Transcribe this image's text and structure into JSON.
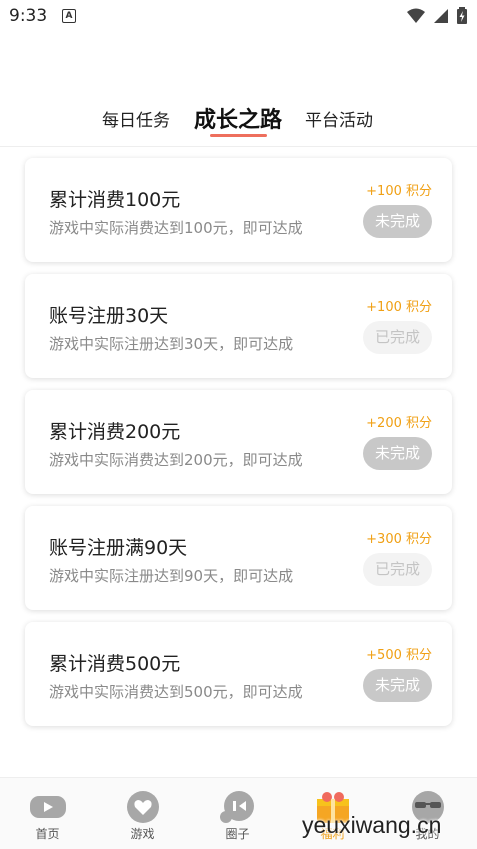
{
  "status_bar": {
    "time": "9:33",
    "notification_icon_letter": "A"
  },
  "tabs": [
    {
      "label": "每日任务",
      "active": false
    },
    {
      "label": "成长之路",
      "active": true
    },
    {
      "label": "平台活动",
      "active": false
    }
  ],
  "accent_colors": {
    "tab_underline": "#ee6f5d",
    "points": "#f0a015"
  },
  "tasks": [
    {
      "title": "累计消费100元",
      "desc": "游戏中实际消费达到100元，即可达成",
      "points": "+100 积分",
      "status": "未完成",
      "state": "pending"
    },
    {
      "title": "账号注册30天",
      "desc": "游戏中实际注册达到30天，即可达成",
      "points": "+100 积分",
      "status": "已完成",
      "state": "done"
    },
    {
      "title": "累计消费200元",
      "desc": "游戏中实际消费达到200元，即可达成",
      "points": "+200 积分",
      "status": "未完成",
      "state": "pending"
    },
    {
      "title": "账号注册满90天",
      "desc": "游戏中实际注册达到90天，即可达成",
      "points": "+300 积分",
      "status": "已完成",
      "state": "done"
    },
    {
      "title": "累计消费500元",
      "desc": "游戏中实际消费达到500元，即可达成",
      "points": "+500 积分",
      "status": "未完成",
      "state": "pending"
    }
  ],
  "bottom_nav": [
    {
      "label": "首页",
      "icon": "gamepad-icon",
      "active": false
    },
    {
      "label": "游戏",
      "icon": "heart-chat-icon",
      "active": false
    },
    {
      "label": "圈子",
      "icon": "chat-bubble-icon",
      "active": false
    },
    {
      "label": "福利",
      "icon": "gift-icon",
      "active": true
    },
    {
      "label": "我的",
      "icon": "sunglasses-face-icon",
      "active": false
    }
  ],
  "watermark": "yeuxiwang.cn"
}
